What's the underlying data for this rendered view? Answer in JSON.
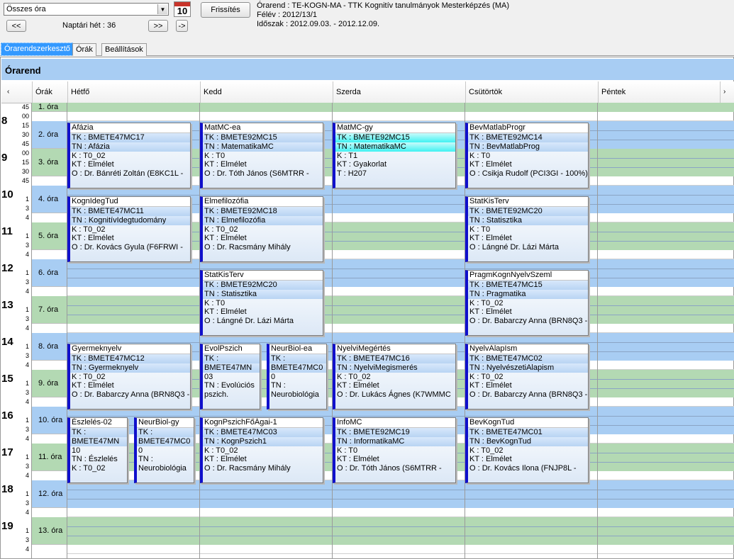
{
  "toolbar": {
    "combo_value": "Összes óra",
    "calendar_day": "10",
    "refresh_label": "Frissítés",
    "prev_label": "<<",
    "next_label": ">>",
    "last_label": "->",
    "week_label": "Naptári hét : 36"
  },
  "info": {
    "line1": "Órarend : TE-KOGN-MA - TTK Kognitív tanulmányok Mesterképzés (MA)",
    "line2": "Félév : 2012/13/1",
    "line3": "Időszak : 2012.09.03. - 2012.12.09."
  },
  "tabs": [
    {
      "label": "Órarendszerkesztő",
      "active": true
    },
    {
      "label": "Órák",
      "active": false
    },
    {
      "label": "Beállítások",
      "active": false
    }
  ],
  "panel_title": "Órarend",
  "header": {
    "scroll_left": "‹",
    "col_ora": "Órák",
    "days": [
      "Hétfő",
      "Kedd",
      "Szerda",
      "Csütörtök",
      "Péntek"
    ],
    "scroll_right": "›"
  },
  "colors": {
    "blue": "#a8cdf3",
    "green": "#b3d9b3",
    "accent": "#1010cc"
  },
  "time_labels": [
    {
      "hour": "",
      "mins": [
        "45"
      ]
    },
    {
      "hour": "8",
      "mins": [
        "00",
        "15",
        "30",
        "45"
      ]
    },
    {
      "hour": "9",
      "mins": [
        "00",
        "15",
        "30",
        "45"
      ]
    },
    {
      "hour": "10",
      "mins": [
        "",
        "1",
        "3",
        "4"
      ]
    },
    {
      "hour": "11",
      "mins": [
        "",
        "1",
        "3",
        "4"
      ]
    },
    {
      "hour": "12",
      "mins": [
        "",
        "1",
        "3",
        "4"
      ]
    },
    {
      "hour": "13",
      "mins": [
        "",
        "1",
        "3",
        "4"
      ]
    },
    {
      "hour": "14",
      "mins": [
        "",
        "1",
        "3",
        "4"
      ]
    },
    {
      "hour": "15",
      "mins": [
        "",
        "1",
        "3",
        "4"
      ]
    },
    {
      "hour": "16",
      "mins": [
        "",
        "1",
        "3",
        "4"
      ]
    },
    {
      "hour": "17",
      "mins": [
        "",
        "1",
        "3",
        "4"
      ]
    },
    {
      "hour": "18",
      "mins": [
        "",
        "1",
        "3",
        "4"
      ]
    },
    {
      "hour": "19",
      "mins": [
        "",
        "1",
        "3",
        "4"
      ]
    }
  ],
  "blocks": [
    "1. óra",
    "2. óra",
    "3. óra",
    "4. óra",
    "5. óra",
    "6. óra",
    "7. óra",
    "8. óra",
    "9. óra",
    "10. óra",
    "11. óra",
    "12. óra",
    "13. óra"
  ],
  "cards": [
    {
      "day": 0,
      "slot": 1,
      "title": "Afázia",
      "lines": [
        "TK : BMETE47MC17",
        "TN : Afázia",
        "K : T0_02",
        "KT : Elmélet",
        "O : Dr. Bánréti Zoltán (E8KC1L -"
      ]
    },
    {
      "day": 1,
      "slot": 1,
      "title": "MatMC-ea",
      "lines": [
        "TK : BMETE92MC15",
        "TN : MatematikaMC",
        "K : T0",
        "KT : Elmélet",
        "O : Dr. Tóth János (S6MTRR -"
      ]
    },
    {
      "day": 2,
      "slot": 1,
      "title": "MatMC-gy",
      "cyan": true,
      "lines": [
        "TK : BMETE92MC15",
        "TN : MatematikaMC",
        "K : T1",
        "KT : Gyakorlat",
        "T : H207"
      ]
    },
    {
      "day": 3,
      "slot": 1,
      "title": "BevMatlabProgr",
      "lines": [
        "TK : BMETE92MC14",
        "TN : BevMatlabProg",
        "K : T0",
        "KT : Elmélet",
        "O : Csikja Rudolf (PCI3GI - 100%)"
      ]
    },
    {
      "day": 0,
      "slot": 3,
      "title": "KognIdegTud",
      "lines": [
        "TK : BMETE47MC11",
        "TN : KognitívIdegtudomány",
        "K : T0_02",
        "KT : Elmélet",
        "O : Dr. Kovács Gyula (F6FRWI -"
      ]
    },
    {
      "day": 1,
      "slot": 3,
      "title": "Elmefilozófia",
      "lines": [
        "TK : BMETE92MC18",
        "TN : Elmefilozófia",
        "K : T0_02",
        "KT : Elmélet",
        "O : Dr. Racsmány Mihály"
      ]
    },
    {
      "day": 3,
      "slot": 3,
      "title": "StatKisTerv",
      "lines": [
        "TK : BMETE92MC20",
        "TN : Statisztika",
        "K : T0",
        "KT : Elmélet",
        "O : Lángné Dr. Lázi Márta"
      ]
    },
    {
      "day": 1,
      "slot": 5,
      "title": "StatKisTerv",
      "lines": [
        "TK : BMETE92MC20",
        "TN : Statisztika",
        "K : T0",
        "KT : Elmélet",
        "O : Lángné Dr. Lázi Márta"
      ]
    },
    {
      "day": 3,
      "slot": 5,
      "title": "PragmKognNyelvSzeml",
      "lines": [
        "TK : BMETE47MC15",
        "TN : Pragmatika",
        "K : T0_02",
        "KT : Elmélet",
        "O : Dr. Babarczy Anna (BRN8Q3 -"
      ]
    },
    {
      "day": 0,
      "slot": 7,
      "title": "Gyermeknyelv",
      "lines": [
        "TK : BMETE47MC12",
        "TN : Gyermeknyelv",
        "K : T0_02",
        "KT : Elmélet",
        "O : Dr. Babarczy Anna (BRN8Q3 -"
      ]
    },
    {
      "day": 1,
      "slot": 7,
      "half": 0,
      "title": "EvolPszich",
      "lines": [
        "TK :",
        "BMETE47MN",
        "03",
        "TN : Evolúciós",
        "pszich."
      ]
    },
    {
      "day": 1,
      "slot": 7,
      "half": 1,
      "title": "NeurBiol-ea",
      "lines": [
        "TK :",
        "BMETE47MC0",
        "0",
        "TN :",
        "Neurobiológia"
      ]
    },
    {
      "day": 2,
      "slot": 7,
      "title": "NyelviMegértés",
      "lines": [
        "TK : BMETE47MC16",
        "TN : NyelviMegismerés",
        "K : T0_02",
        "KT : Elmélet",
        "O : Dr. Lukács Ágnes (K7WMMC"
      ]
    },
    {
      "day": 3,
      "slot": 7,
      "title": "NyelvAlapIsm",
      "lines": [
        "TK : BMETE47MC02",
        "TN : NyelvészetiAlapism",
        "K : T0_02",
        "KT : Elmélet",
        "O : Dr. Babarczy Anna (BRN8Q3 -"
      ]
    },
    {
      "day": 0,
      "slot": 9,
      "half": 0,
      "title": "Észlelés-02",
      "lines": [
        "TK :",
        "BMETE47MN",
        "10",
        "TN : Észlelés",
        "K : T0_02"
      ]
    },
    {
      "day": 0,
      "slot": 9,
      "half": 1,
      "title": "NeurBiol-gy",
      "lines": [
        "TK :",
        "BMETE47MC0",
        "0",
        "TN :",
        "Neurobiológia"
      ]
    },
    {
      "day": 1,
      "slot": 9,
      "title": "KognPszichFőÁgai-1",
      "lines": [
        "TK : BMETE47MC03",
        "TN : KognPszich1",
        "K : T0_02",
        "KT : Elmélet",
        "O : Dr. Racsmány Mihály"
      ]
    },
    {
      "day": 2,
      "slot": 9,
      "title": "InfoMC",
      "lines": [
        "TK : BMETE92MC19",
        "TN : InformatikaMC",
        "K : T0",
        "KT : Elmélet",
        "O : Dr. Tóth János (S6MTRR -"
      ]
    },
    {
      "day": 3,
      "slot": 9,
      "title": "BevKognTud",
      "lines": [
        "TK : BMETE47MC01",
        "TN : BevKognTud",
        "K : T0_02",
        "KT : Elmélet",
        "O : Dr. Kovács Ilona (FNJP8L -"
      ]
    }
  ]
}
